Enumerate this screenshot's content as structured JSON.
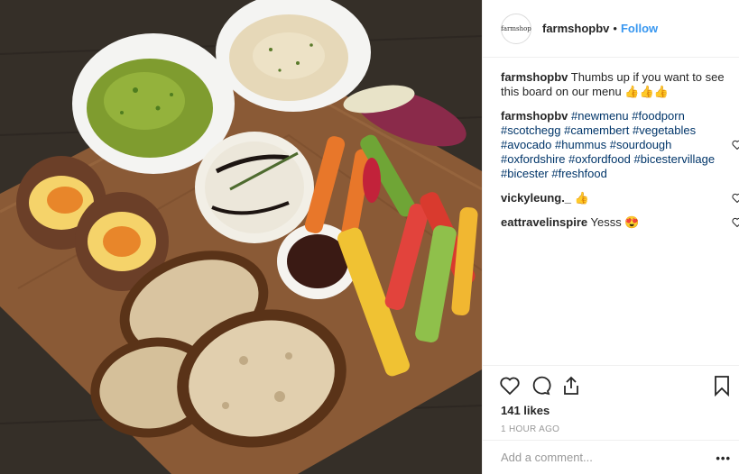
{
  "post": {
    "image_alt": "Food board with avocado, hummus, scotch eggs, camembert, vegetables and sourdough"
  },
  "header": {
    "avatar_text": "farmshop",
    "username": "farmshopbv",
    "separator": "•",
    "follow_label": "Follow"
  },
  "comments": [
    {
      "user": "farmshopbv",
      "text": "Thumbs up if you want to see this board on our menu 👍👍👍"
    },
    {
      "user": "farmshopbv",
      "tags": [
        "#newmenu",
        "#foodporn",
        "#scotchegg",
        "#camembert",
        "#vegetables",
        "#avocado",
        "#hummus",
        "#sourdough",
        "#oxfordshire",
        "#oxfordfood",
        "#bicestervillage",
        "#bicester",
        "#freshfood"
      ]
    },
    {
      "user": "vickyleung._",
      "text": "👍"
    },
    {
      "user": "eattravelinspire",
      "text": "Yesss 😍"
    }
  ],
  "footer": {
    "likes": "141 likes",
    "time": "1 HOUR AGO",
    "add_comment_placeholder": "Add a comment...",
    "more": "•••"
  },
  "icons": {
    "like": "heart-icon",
    "comment": "comment-icon",
    "share": "share-icon",
    "save": "bookmark-icon",
    "comment_like": "heart-icon"
  },
  "colors": {
    "link": "#3897f0",
    "hashtag": "#003569",
    "muted": "#999999",
    "border": "#efefef"
  }
}
